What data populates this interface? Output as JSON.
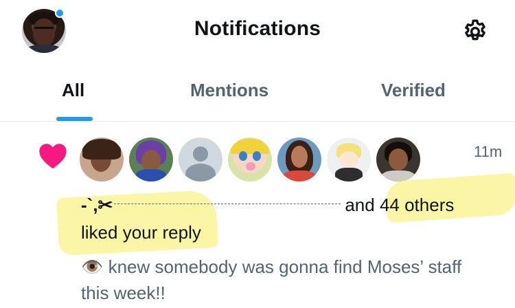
{
  "header": {
    "title": "Notifications",
    "avatar_icon": "user-avatar",
    "settings_icon": "gear-icon",
    "unread_dot_color": "#1d9bf0"
  },
  "tabs": [
    {
      "label": "All",
      "active": true
    },
    {
      "label": "Mentions",
      "active": false
    },
    {
      "label": "Verified",
      "active": false
    }
  ],
  "notification": {
    "icon": "heart-icon",
    "icon_color": "#f91880",
    "time": "11m",
    "actor_name": "-`,✂︎",
    "connector": "and",
    "others": "44 others",
    "action": "liked your reply",
    "reply_text": "👁️ knew somebody was gonna find Moses’ staff this week!!",
    "likers_count": 7
  },
  "colors": {
    "accent": "#1d9bf0",
    "highlight": "#fbf6a5",
    "secondary_text": "#536471"
  }
}
